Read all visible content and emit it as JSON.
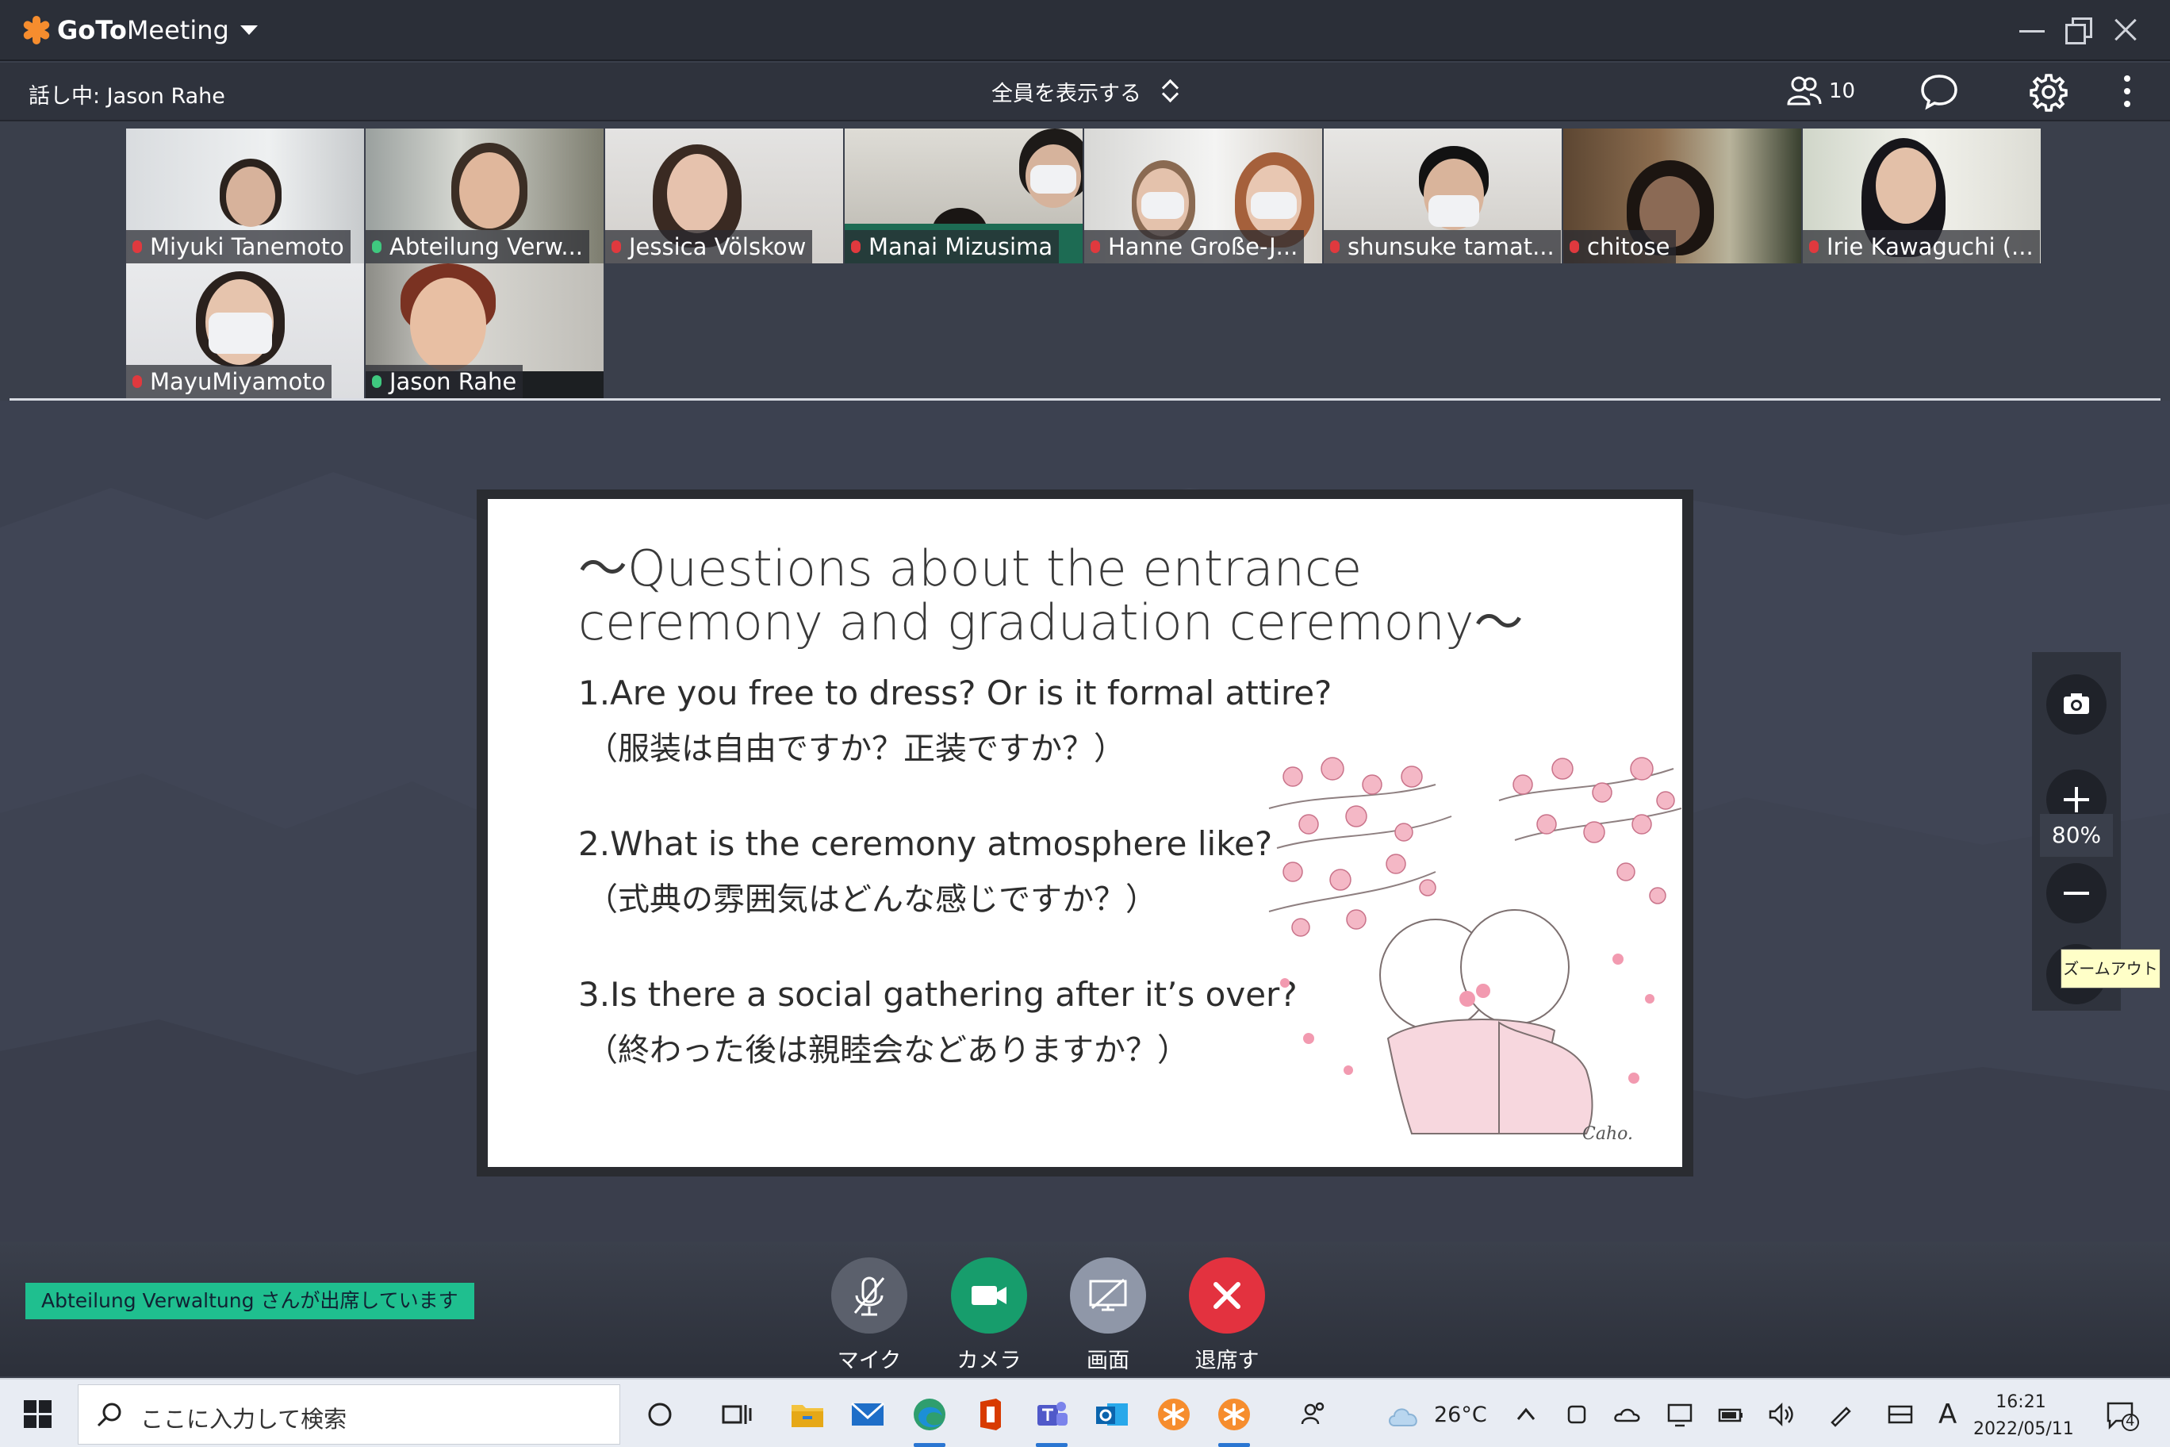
{
  "app": {
    "brand_bold": "GoTo",
    "brand_light": "Meeting"
  },
  "toolbar": {
    "speaking": "話し中: Jason Rahe",
    "view_all": "全員を表示する",
    "attendee_count": "10"
  },
  "participants": [
    {
      "name": "Miyuki Tanemoto",
      "mic": "off"
    },
    {
      "name": "Abteilung Verw...",
      "mic": "on"
    },
    {
      "name": "Jessica Völskow",
      "mic": "off"
    },
    {
      "name": "Manai Mizusima",
      "mic": "off"
    },
    {
      "name": "Hanne Große-J...",
      "mic": "off"
    },
    {
      "name": "shunsuke tamat...",
      "mic": "off"
    },
    {
      "name": "chitose",
      "mic": "off"
    },
    {
      "name": "Irie Kawaguchi (...",
      "mic": "off"
    },
    {
      "name": "MayuMiyamoto",
      "mic": "off"
    },
    {
      "name": "Jason Rahe",
      "mic": "on"
    }
  ],
  "slide": {
    "title": "～Questions about the entrance ceremony and graduation ceremony～",
    "q1_en": "1.Are you free to dress? Or is it formal attire?",
    "q1_ja": "（服装は自由ですか？正装ですか？）",
    "q2_en": "2.What is the ceremony atmosphere like?",
    "q2_ja": "（式典の雰囲気はどんな感じですか？）",
    "q3_en": "3.Is there a social gathering after it’s over?",
    "q3_ja": "（終わった後は親睦会などありますか？）",
    "signature": "Caho."
  },
  "zoom": {
    "level": "80%",
    "tooltip": "ズームアウト"
  },
  "notification": "Abteilung  Verwaltung さんが出席しています",
  "controls": {
    "mic": "マイク",
    "camera": "カメラ",
    "screen": "画面",
    "leave": "退席する"
  },
  "taskbar": {
    "search_placeholder": "ここに入力して検索",
    "temperature": "26°C",
    "time": "16:21",
    "date": "2022/05/11",
    "ime": "A",
    "notifications": "4"
  },
  "colors": {
    "brand_orange": "#f68d2e",
    "camera_green": "#179d6c",
    "leave_red": "#e3323f",
    "notify_green": "#1fbf8f"
  }
}
